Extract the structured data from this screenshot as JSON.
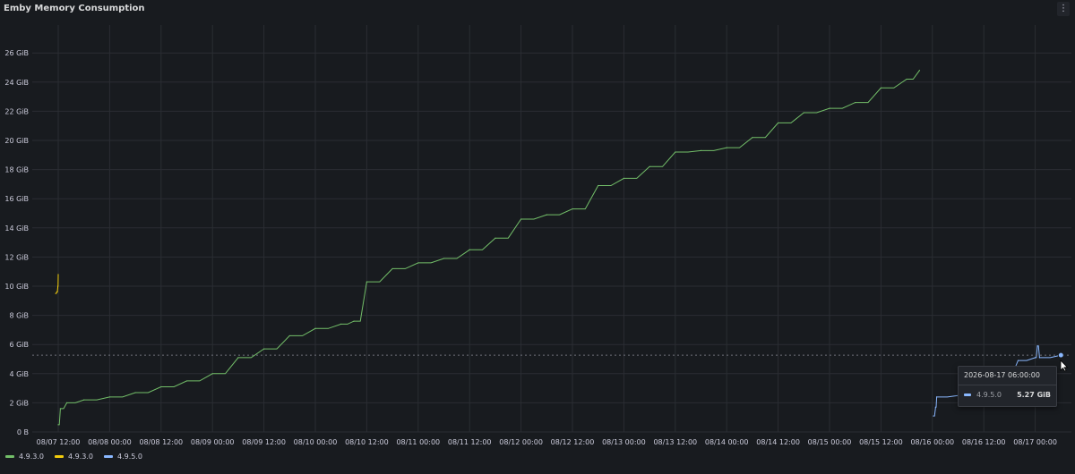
{
  "panel": {
    "title": "Emby Memory Consumption",
    "menu_icon": "vertical-dots-icon"
  },
  "chart_data": {
    "type": "line",
    "title": "Emby Memory Consumption",
    "xlabel": "",
    "ylabel": "",
    "ylim": [
      0,
      27.5
    ],
    "y_unit": "GiB",
    "y_ticks": [
      "0 B",
      "2 GiB",
      "4 GiB",
      "6 GiB",
      "8 GiB",
      "10 GiB",
      "12 GiB",
      "14 GiB",
      "16 GiB",
      "18 GiB",
      "20 GiB",
      "22 GiB",
      "24 GiB",
      "26 GiB"
    ],
    "x_ticks": [
      "08/07 12:00",
      "08/08 00:00",
      "08/08 12:00",
      "08/09 00:00",
      "08/09 12:00",
      "08/10 00:00",
      "08/10 12:00",
      "08/11 00:00",
      "08/11 12:00",
      "08/12 00:00",
      "08/12 12:00",
      "08/13 00:00",
      "08/13 12:00",
      "08/14 00:00",
      "08/14 12:00",
      "08/15 00:00",
      "08/15 12:00",
      "08/16 00:00",
      "08/16 12:00",
      "08/17 00:00"
    ],
    "grid": true,
    "legend_position": "bottom-left",
    "series": [
      {
        "name": "4.9.3.0",
        "color": "#73bf69",
        "x": [
          "2026-08-07 12:00",
          "2026-08-07 12:30",
          "2026-08-07 14:00",
          "2026-08-07 18:00",
          "2026-08-08 00:00",
          "2026-08-08 06:00",
          "2026-08-08 12:00",
          "2026-08-08 18:00",
          "2026-08-09 00:00",
          "2026-08-09 06:00",
          "2026-08-09 12:00",
          "2026-08-09 18:00",
          "2026-08-10 00:00",
          "2026-08-10 06:00",
          "2026-08-10 09:00",
          "2026-08-10 12:00",
          "2026-08-10 18:00",
          "2026-08-11 00:00",
          "2026-08-11 06:00",
          "2026-08-11 12:00",
          "2026-08-11 18:00",
          "2026-08-12 00:00",
          "2026-08-12 06:00",
          "2026-08-12 12:00",
          "2026-08-12 18:00",
          "2026-08-13 00:00",
          "2026-08-13 06:00",
          "2026-08-13 12:00",
          "2026-08-13 18:00",
          "2026-08-14 00:00",
          "2026-08-14 06:00",
          "2026-08-14 12:00",
          "2026-08-14 18:00",
          "2026-08-15 00:00",
          "2026-08-15 06:00",
          "2026-08-15 12:00",
          "2026-08-15 18:00",
          "2026-08-15 21:00"
        ],
        "values": [
          0.5,
          1.6,
          2.0,
          2.2,
          2.4,
          2.7,
          3.1,
          3.5,
          4.0,
          5.1,
          5.7,
          6.6,
          7.1,
          7.4,
          7.6,
          10.3,
          11.2,
          11.6,
          11.9,
          12.5,
          13.3,
          14.6,
          14.9,
          15.3,
          16.9,
          17.4,
          18.2,
          19.2,
          19.3,
          19.5,
          20.2,
          21.2,
          21.9,
          22.2,
          22.6,
          23.6,
          24.2,
          24.8
        ]
      },
      {
        "name": "4.9.3.0",
        "color": "#f2cc0c",
        "x": [
          "2026-08-07 11:25",
          "2026-08-07 11:40",
          "2026-08-07 11:55",
          "2026-08-07 12:00"
        ],
        "values": [
          9.5,
          9.6,
          10.0,
          10.8
        ]
      },
      {
        "name": "4.9.5.0",
        "color": "#8ab8ff",
        "x": [
          "2026-08-16 00:15",
          "2026-08-16 00:45",
          "2026-08-16 01:00",
          "2026-08-16 06:00",
          "2026-08-16 12:00",
          "2026-08-16 18:00",
          "2026-08-16 20:00",
          "2026-08-17 00:00",
          "2026-08-17 00:30",
          "2026-08-17 01:00",
          "2026-08-17 06:00"
        ],
        "values": [
          1.1,
          1.7,
          2.4,
          2.5,
          2.5,
          4.2,
          4.9,
          5.1,
          5.9,
          5.1,
          5.27
        ]
      }
    ]
  },
  "legend": {
    "items": [
      {
        "label": "4.9.3.0",
        "color": "#73bf69"
      },
      {
        "label": "4.9.3.0",
        "color": "#f2cc0c"
      },
      {
        "label": "4.9.5.0",
        "color": "#8ab8ff"
      }
    ]
  },
  "tooltip": {
    "time": "2026-08-17 06:00:00",
    "series_name": "4.9.5.0",
    "series_color": "#8ab8ff",
    "value": "5.27 GiB"
  }
}
